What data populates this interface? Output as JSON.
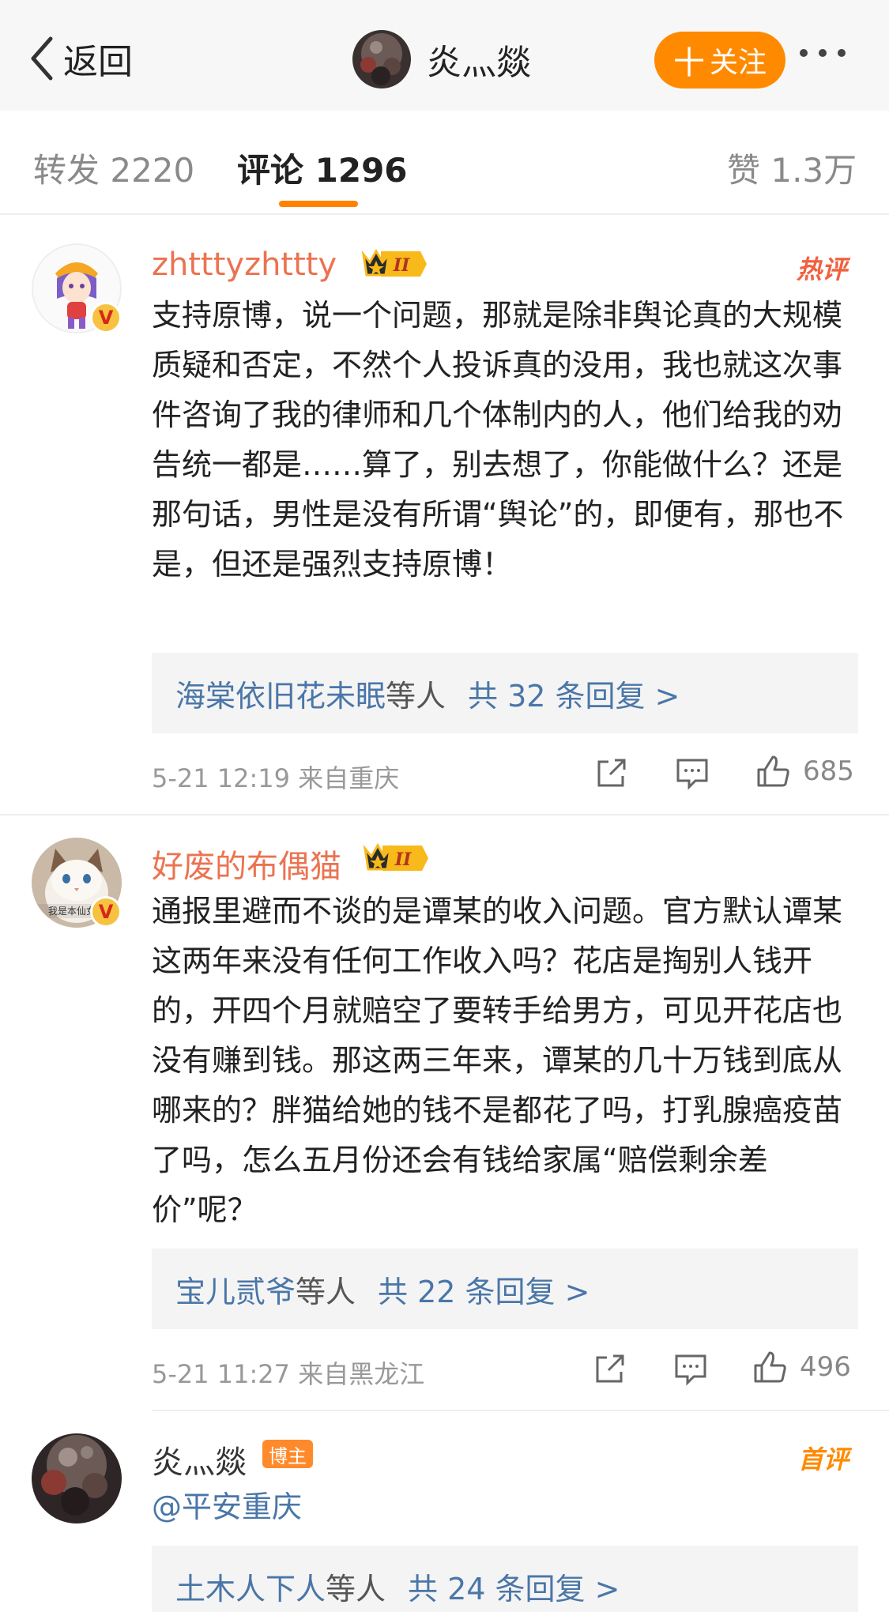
{
  "header": {
    "back_label": "返回",
    "title": "炎灬燚",
    "follow_label": "关注",
    "follow_plus": "十"
  },
  "tabs": {
    "repost": "转发 2220",
    "comments": "评论 1296",
    "likes": "赞 1.3万"
  },
  "comments": [
    {
      "user": "zhtttyzhttty",
      "badge_level": "II",
      "tag": "热评",
      "text": "支持原博，说一个问题，那就是除非舆论真的大规模质疑和否定，不然个人投诉真的没用，我也就这次事件咨询了我的律师和几个体制内的人，他们给我的劝告统一都是……算了，别去想了，你能做什么？还是那句话，男性是没有所谓“舆论”的，即便有，那也不是，但还是强烈支持原博！",
      "replies_user": "海棠依旧花未眠",
      "replies_mid": "等人",
      "replies_count": "共 32 条回复 >",
      "meta": "5-21 12:19  来自重庆",
      "likes": "685"
    },
    {
      "user": "好废的布偶猫",
      "badge_level": "II",
      "avatar_caption": "我是本仙女的",
      "text": "通报里避而不谈的是谭某的收入问题。官方默认谭某这两年来没有任何工作收入吗？花店是掏别人钱开的，开四个月就赔空了要转手给男方，可见开花店也没有赚到钱。那这两三年来，谭某的几十万钱到底从哪来的？胖猫给她的钱不是都花了吗，打乳腺癌疫苗了吗，怎么五月份还会有钱给家属“赔偿剩余差价”呢？",
      "replies_user": "宝儿贰爷",
      "replies_mid": "等人",
      "replies_count": "共 22 条回复 >",
      "meta": "5-21 11:27  来自黑龙江",
      "likes": "496"
    },
    {
      "user": "炎灬燚",
      "owner_tag": "博主",
      "tag": "首评",
      "text": "@平安重庆",
      "replies_user": "土木人下人",
      "replies_mid": "等人",
      "replies_count": "共 24 条回复 >"
    }
  ],
  "verified_mark": "V",
  "colors": {
    "accent": "#ff8200",
    "link": "#4a76a8",
    "username": "#eb7350"
  },
  "icons": [
    "chevron-left-icon",
    "share-icon",
    "comment-icon",
    "like-icon",
    "crown-icon",
    "verified-icon"
  ]
}
